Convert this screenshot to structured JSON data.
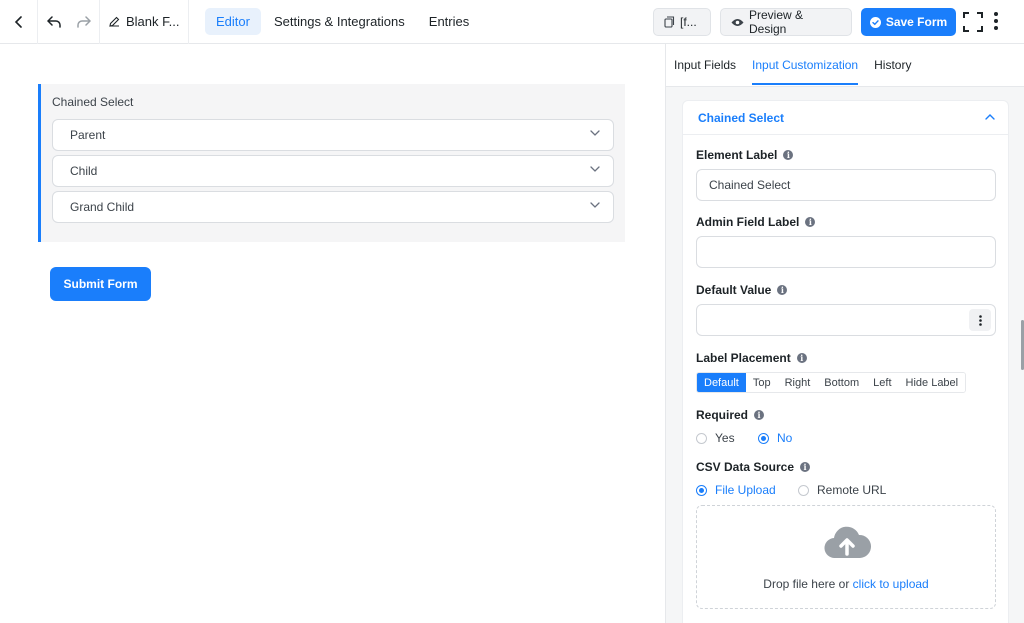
{
  "topbar": {
    "back_icon": "chevron-left-icon",
    "undo_icon": "undo-icon",
    "redo_icon": "redo-icon",
    "form_title": "Blank F...",
    "tabs": [
      {
        "label": "Editor",
        "active": true
      },
      {
        "label": "Settings & Integrations",
        "active": false
      },
      {
        "label": "Entries",
        "active": false
      }
    ],
    "shortcode_label": "[f...",
    "preview_label": "Preview & Design",
    "save_label": "Save Form"
  },
  "editor": {
    "field_label": "Chained Select",
    "selects": [
      "Parent",
      "Child",
      "Grand Child"
    ],
    "submit_label": "Submit Form"
  },
  "panel": {
    "tabs": [
      {
        "label": "Input Fields",
        "active": false
      },
      {
        "label": "Input Customization",
        "active": true
      },
      {
        "label": "History",
        "active": false
      }
    ],
    "section_title": "Chained Select",
    "element_label": {
      "label": "Element Label",
      "value": "Chained Select"
    },
    "admin_field_label": {
      "label": "Admin Field Label",
      "value": ""
    },
    "default_value": {
      "label": "Default Value",
      "value": ""
    },
    "label_placement": {
      "label": "Label Placement",
      "options": [
        "Default",
        "Top",
        "Right",
        "Bottom",
        "Left",
        "Hide Label"
      ],
      "selected": "Default"
    },
    "required": {
      "label": "Required",
      "options": [
        "Yes",
        "No"
      ],
      "selected": "No"
    },
    "csv_source": {
      "label": "CSV Data Source",
      "options": [
        "File Upload",
        "Remote URL"
      ],
      "selected": "File Upload"
    },
    "dropzone": {
      "text": "Drop file here or",
      "link": "click to upload",
      "icon": "cloud-upload-icon"
    }
  },
  "colors": {
    "accent": "#1a7efb",
    "panel_bg": "#f5f6f7"
  }
}
